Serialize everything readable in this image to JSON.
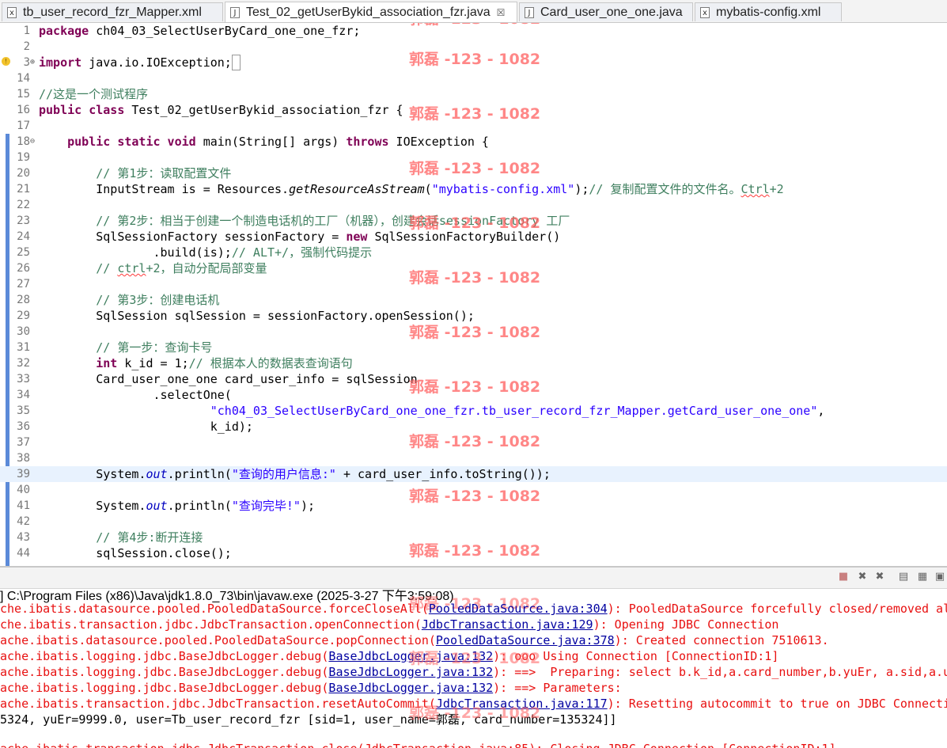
{
  "tabs": [
    {
      "label": "tb_user_record_fzr_Mapper.xml",
      "icon": "xml-file-icon",
      "active": false
    },
    {
      "label": "Test_02_getUserBykid_association_fzr.java",
      "icon": "java-file-icon",
      "active": true,
      "close": "☒"
    },
    {
      "label": "Card_user_one_one.java",
      "icon": "java-file-icon",
      "active": false
    },
    {
      "label": "mybatis-config.xml",
      "icon": "xml-file-icon",
      "active": false
    }
  ],
  "editor": {
    "line_numbers": [
      "1",
      "2",
      "3",
      "14",
      "15",
      "16",
      "17",
      "18",
      "19",
      "20",
      "21",
      "22",
      "23",
      "24",
      "25",
      "26",
      "27",
      "28",
      "29",
      "30",
      "31",
      "32",
      "33",
      "34",
      "35",
      "36",
      "37",
      "38",
      "39",
      "40",
      "41",
      "42",
      "43",
      "44"
    ],
    "current_line": "39",
    "watermark": "郭磊 -123 - 1082"
  },
  "console": {
    "header": "] C:\\Program Files (x86)\\Java\\jdk1.8.0_73\\bin\\javaw.exe (2025-3-27 下午3:59:08)",
    "lines": [
      {
        "pre": "che.ibatis.datasource.pooled.PooledDataSource.forceCloseAll(",
        "link": "PooledDataSource.java:304",
        "post": "): PooledDataSource forcefully closed/removed all"
      },
      {
        "pre": "che.ibatis.transaction.jdbc.JdbcTransaction.openConnection(",
        "link": "JdbcTransaction.java:129",
        "post": "): Opening JDBC Connection"
      },
      {
        "pre": "ache.ibatis.datasource.pooled.PooledDataSource.popConnection(",
        "link": "PooledDataSource.java:378",
        "post": "): Created connection 7510613."
      },
      {
        "pre": "ache.ibatis.logging.jdbc.BaseJdbcLogger.debug(",
        "link": "BaseJdbcLogger.java:132",
        "post": "): ooo Using Connection [ConnectionID:1]"
      },
      {
        "pre": "ache.ibatis.logging.jdbc.BaseJdbcLogger.debug(",
        "link": "BaseJdbcLogger.java:132",
        "post": "): ==>  Preparing: select b.k_id,a.card_number,b.yuEr, a.sid,a.us"
      },
      {
        "pre": "ache.ibatis.logging.jdbc.BaseJdbcLogger.debug(",
        "link": "BaseJdbcLogger.java:132",
        "post": "): ==> Parameters:"
      },
      {
        "pre": "ache.ibatis.transaction.jdbc.JdbcTransaction.resetAutoCommit(",
        "link": "JdbcTransaction.java:117",
        "post": "): Resetting autocommit to true on JDBC Connectio"
      }
    ],
    "output_line": "5324, yuEr=9999.0, user=Tb_user_record_fzr [sid=1, user_name=郭磊, card_number=135324]]",
    "cut_line": "ache.ibatis.transaction.jdbc.JdbcTransaction.close(JdbcTransaction.java:85): Closing JDBC Connection [ConnectionID:1]"
  },
  "colors": {
    "keyword": "#7f0055",
    "string": "#2a00ff",
    "comment": "#3f7f5f",
    "field": "#0000c0",
    "error_text": "#e81010",
    "watermark": "#ff6060"
  }
}
